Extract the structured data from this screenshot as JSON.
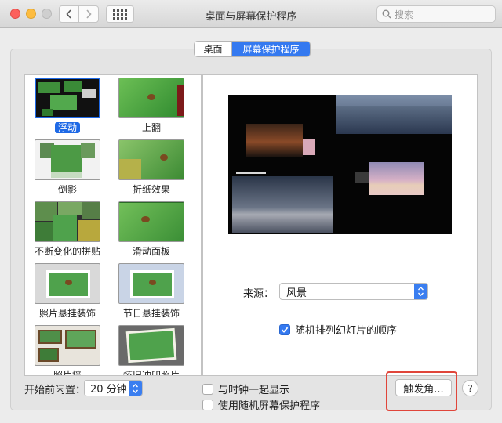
{
  "window": {
    "title": "桌面与屏幕保护程序"
  },
  "search": {
    "placeholder": "搜索"
  },
  "tabs": [
    {
      "label": "桌面",
      "active": false
    },
    {
      "label": "屏幕保护程序",
      "active": true
    }
  ],
  "screensavers": [
    {
      "label": "浮动",
      "selected": true
    },
    {
      "label": "上翻",
      "selected": false
    },
    {
      "label": "倒影",
      "selected": false
    },
    {
      "label": "折纸效果",
      "selected": false
    },
    {
      "label": "不断变化的拼贴",
      "selected": false
    },
    {
      "label": "滑动面板",
      "selected": false
    },
    {
      "label": "照片悬挂装饰",
      "selected": false
    },
    {
      "label": "节日悬挂装饰",
      "selected": false
    },
    {
      "label": "照片墙",
      "selected": false
    },
    {
      "label": "怀旧冲印照片",
      "selected": false
    }
  ],
  "source": {
    "label": "来源：",
    "value": "风景"
  },
  "shuffle": {
    "label": "随机排列幻灯片的顺序",
    "checked": true
  },
  "idle": {
    "label": "开始前闲置：",
    "value": "20 分钟"
  },
  "show_clock": {
    "label": "与时钟一起显示",
    "checked": false
  },
  "random_saver": {
    "label": "使用随机屏幕保护程序",
    "checked": false
  },
  "hot_corners": {
    "label": "触发角..."
  },
  "help": {
    "label": "?"
  },
  "colors": {
    "accent": "#3479f0",
    "highlight_box": "#e0453a"
  }
}
